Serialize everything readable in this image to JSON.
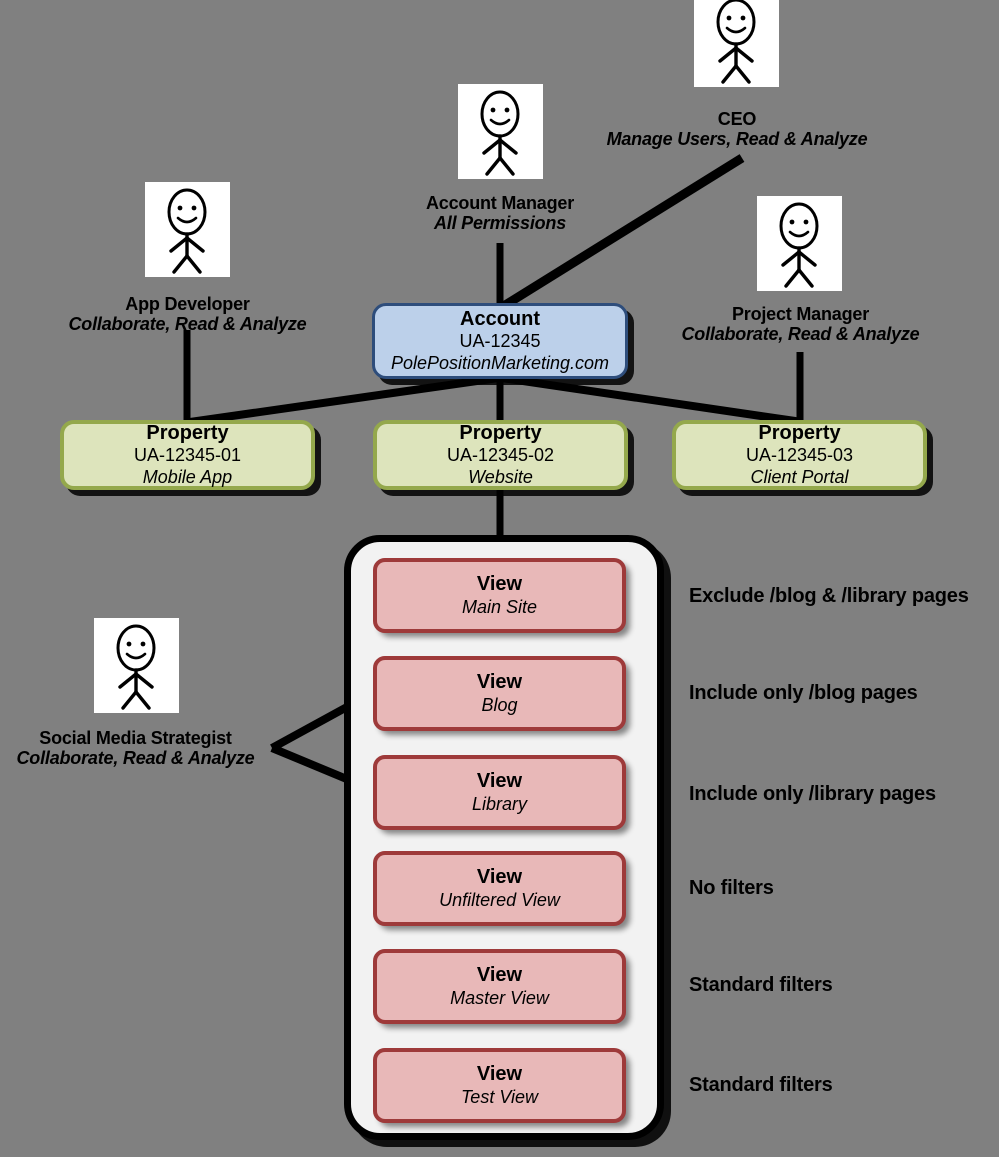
{
  "diagram": {
    "background_color": "#808080",
    "roles": [
      {
        "id": "app-developer",
        "title": "App Developer",
        "permissions": "Collaborate, Read & Analyze"
      },
      {
        "id": "account-manager",
        "title": "Account Manager",
        "permissions": "All Permissions"
      },
      {
        "id": "ceo",
        "title": "CEO",
        "permissions": "Manage Users, Read & Analyze"
      },
      {
        "id": "project-manager",
        "title": "Project Manager",
        "permissions": "Collaborate, Read & Analyze"
      },
      {
        "id": "social-media-strategist",
        "title": "Social Media Strategist",
        "permissions": "Collaborate, Read & Analyze"
      }
    ],
    "account": {
      "title": "Account",
      "id": "UA-12345",
      "sub": "PolePositionMarketing.com",
      "fill_color": "#bcd0ea",
      "border_color": "#2e4d7b"
    },
    "properties": [
      {
        "title": "Property",
        "id": "UA-12345-01",
        "sub": "Mobile App"
      },
      {
        "title": "Property",
        "id": "UA-12345-02",
        "sub": "Website"
      },
      {
        "title": "Property",
        "id": "UA-12345-03",
        "sub": "Client Portal"
      }
    ],
    "property_style": {
      "fill_color": "#dde4bc",
      "border_color": "#94a84c"
    },
    "views": [
      {
        "title": "View",
        "sub": "Main Site",
        "note": "Exclude /blog & /library pages"
      },
      {
        "title": "View",
        "sub": "Blog",
        "note": "Include only /blog pages"
      },
      {
        "title": "View",
        "sub": "Library",
        "note": "Include only /library pages"
      },
      {
        "title": "View",
        "sub": "Unfiltered View",
        "note": "No filters"
      },
      {
        "title": "View",
        "sub": "Master View",
        "note": "Standard filters"
      },
      {
        "title": "View",
        "sub": "Test View",
        "note": "Standard filters"
      }
    ],
    "view_style": {
      "fill_color": "#e8b8b8",
      "border_color": "#9e3a3a"
    },
    "icons": {
      "person": "stick-figure-icon"
    }
  }
}
